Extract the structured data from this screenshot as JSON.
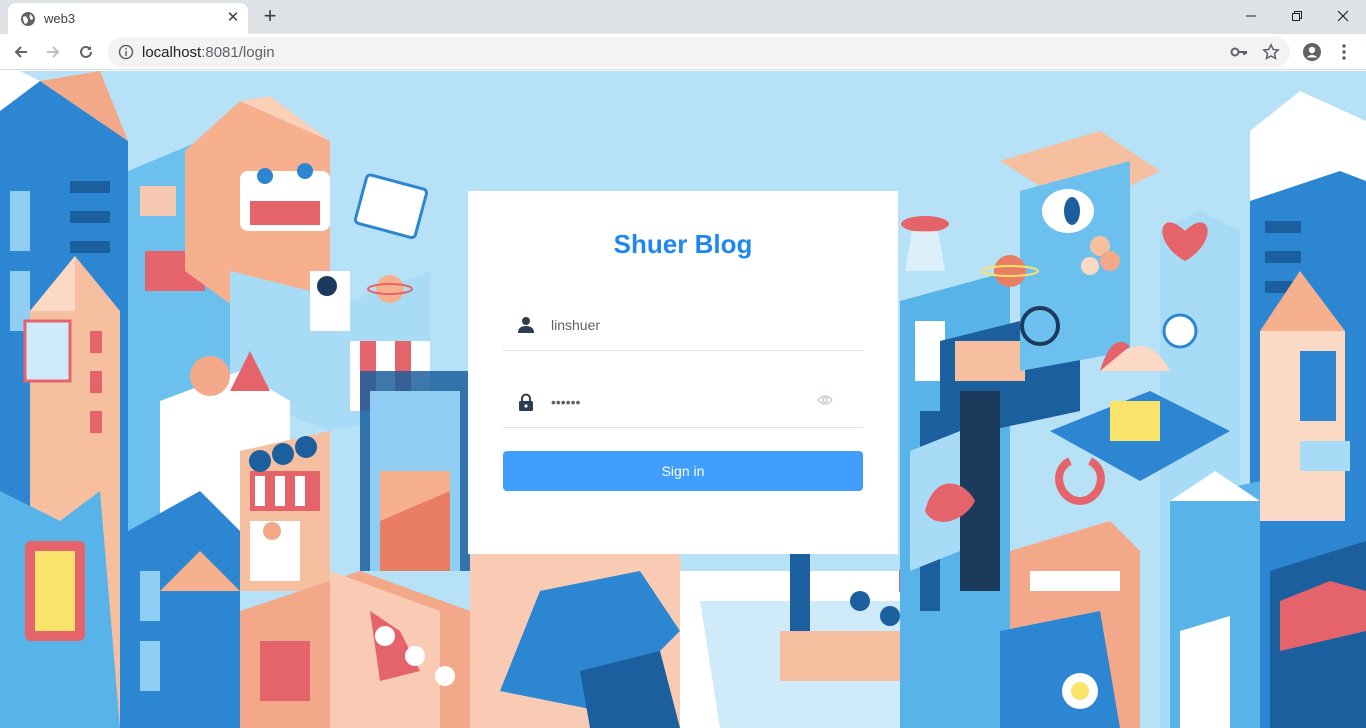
{
  "browser": {
    "tab_title": "web3",
    "url_host": "localhost",
    "url_rest": ":8081/login",
    "new_tab_label": "+",
    "tab_close_label": "✕"
  },
  "login": {
    "title": "Shuer Blog",
    "username_value": "linshuer",
    "password_value": "••••••",
    "signin_label": "Sign in"
  },
  "colors": {
    "brand": "#1e88f0",
    "button": "#409eff",
    "sky": "#b6e1f6"
  },
  "icons": {
    "user": "user-icon",
    "password": "lock-icon",
    "show_password": "eye-icon"
  }
}
